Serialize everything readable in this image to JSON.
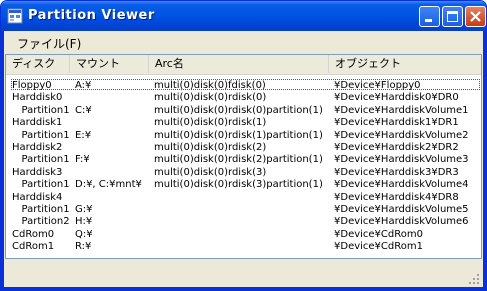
{
  "window": {
    "title": "Partition Viewer",
    "accent": "#0055e5"
  },
  "menu": {
    "file_label": "ファイル(F)"
  },
  "table": {
    "columns": [
      "ディスク",
      "マウント",
      "Arc名",
      "オブジェクト"
    ],
    "rows": [
      [
        "Floppy0",
        "A:¥",
        "multi(0)disk(0)fdisk(0)",
        "¥Device¥Floppy0"
      ],
      [
        "Harddisk0",
        "",
        "multi(0)disk(0)rdisk(0)",
        "¥Device¥Harddisk0¥DR0"
      ],
      [
        "  Partition1",
        "C:¥",
        "multi(0)disk(0)rdisk(0)partition(1)",
        "¥Device¥HarddiskVolume1"
      ],
      [
        "Harddisk1",
        "",
        "multi(0)disk(0)rdisk(1)",
        "¥Device¥Harddisk1¥DR1"
      ],
      [
        "  Partition1",
        "E:¥",
        "multi(0)disk(0)rdisk(1)partition(1)",
        "¥Device¥HarddiskVolume2"
      ],
      [
        "Harddisk2",
        "",
        "multi(0)disk(0)rdisk(2)",
        "¥Device¥Harddisk2¥DR2"
      ],
      [
        "  Partition1",
        "F:¥",
        "multi(0)disk(0)rdisk(2)partition(1)",
        "¥Device¥HarddiskVolume3"
      ],
      [
        "Harddisk3",
        "",
        "multi(0)disk(0)rdisk(3)",
        "¥Device¥Harddisk3¥DR3"
      ],
      [
        "  Partition1",
        "D:¥, C:¥mnt¥",
        "multi(0)disk(0)rdisk(3)partition(1)",
        "¥Device¥HarddiskVolume4"
      ],
      [
        "Harddisk4",
        "",
        "",
        "¥Device¥Harddisk4¥DR8"
      ],
      [
        "  Partition1",
        "G:¥",
        "",
        "¥Device¥HarddiskVolume5"
      ],
      [
        "  Partition2",
        "H:¥",
        "",
        "¥Device¥HarddiskVolume6"
      ],
      [
        "CdRom0",
        "Q:¥",
        "",
        "¥Device¥CdRom0"
      ],
      [
        "CdRom1",
        "R:¥",
        "",
        "¥Device¥CdRom1"
      ]
    ]
  }
}
